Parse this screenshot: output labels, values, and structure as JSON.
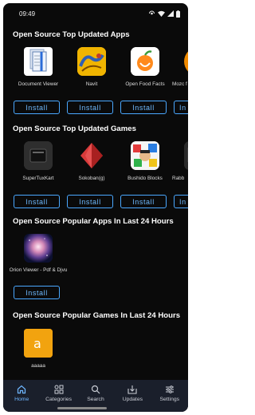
{
  "status": {
    "time": "09:49"
  },
  "sections": [
    {
      "title": "Open Source Top Updated Apps",
      "apps": [
        {
          "name": "Document Viewer",
          "icon": "document-viewer-icon",
          "install": "Install"
        },
        {
          "name": "Navit",
          "icon": "navit-icon",
          "install": "Install"
        },
        {
          "name": "Open Food Facts",
          "icon": "open-food-facts-icon",
          "install": "Install"
        },
        {
          "name": "Mozc f",
          "icon": "mozc-icon",
          "install": "In"
        }
      ]
    },
    {
      "title": "Open Source Top Updated Games",
      "apps": [
        {
          "name": "SuperTuxKart",
          "icon": "supertuxkart-icon",
          "install": "Install"
        },
        {
          "name": "Sokoban(g)",
          "icon": "sokoban-icon",
          "install": "Install"
        },
        {
          "name": "Bushido Blocks",
          "icon": "bushido-blocks-icon",
          "install": "Install"
        },
        {
          "name": "Rabb",
          "icon": "rabbit-icon",
          "install": "In"
        }
      ]
    },
    {
      "title": "Open Source Popular Apps In Last 24 Hours",
      "apps": [
        {
          "name": "Orion Viewer - Pdf & Djvu",
          "icon": "orion-viewer-icon",
          "install": "Install"
        }
      ]
    },
    {
      "title": "Open Source Popular Games In Last 24 Hours",
      "apps": [
        {
          "name": "aaaaa",
          "icon": "aaaaa-icon",
          "install": ""
        }
      ]
    }
  ],
  "nav": [
    {
      "label": "Home",
      "icon": "home-icon",
      "active": true
    },
    {
      "label": "Categories",
      "icon": "categories-icon",
      "active": false
    },
    {
      "label": "Search",
      "icon": "search-icon",
      "active": false
    },
    {
      "label": "Updates",
      "icon": "updates-icon",
      "active": false
    },
    {
      "label": "Settings",
      "icon": "settings-icon",
      "active": false
    }
  ],
  "colors": {
    "accent": "#4aa8ff",
    "background": "#0a0a0a",
    "nav_bg": "#1a1f2b"
  }
}
